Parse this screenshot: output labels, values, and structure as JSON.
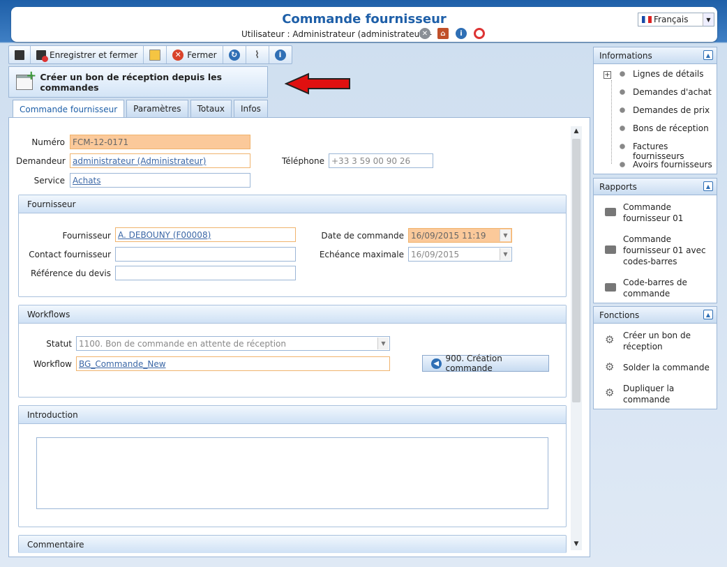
{
  "header": {
    "title": "Commande fournisseur",
    "user_line": "Utilisateur : Administrateur (administrateur)  -",
    "language": "Français"
  },
  "toolbar": {
    "save_close_label": "Enregistrer et fermer",
    "close_label": "Fermer"
  },
  "create_button_label": "Créer un bon de réception depuis les commandes",
  "tabs": [
    "Commande fournisseur",
    "Paramètres",
    "Totaux",
    "Infos"
  ],
  "form": {
    "numero_label": "Numéro",
    "numero_value": "FCM-12-0171",
    "demandeur_label": "Demandeur",
    "demandeur_value": "administrateur (Administrateur)",
    "telephone_label": "Téléphone",
    "telephone_value": "+33 3 59 00 90 26",
    "service_label": "Service",
    "service_value": "Achats"
  },
  "fournisseur_section": {
    "title": "Fournisseur",
    "fournisseur_label": "Fournisseur",
    "fournisseur_value": "A. DEBOUNY (F00008)",
    "contact_label": "Contact fournisseur",
    "contact_value": "",
    "reference_label": "Référence du devis",
    "reference_value": "",
    "date_label": "Date de commande",
    "date_value": "16/09/2015 11:19",
    "echeance_label": "Echéance maximale",
    "echeance_value": "16/09/2015"
  },
  "workflows_section": {
    "title": "Workflows",
    "statut_label": "Statut",
    "statut_value": "1100. Bon de commande en attente de réception",
    "workflow_label": "Workflow",
    "workflow_value": "BG_Commande_New",
    "action_button": "900. Création commande"
  },
  "introduction_section": {
    "title": "Introduction",
    "text": ""
  },
  "commentaire_section": {
    "title": "Commentaire"
  },
  "sidebar": {
    "informations": {
      "title": "Informations",
      "items": [
        "Lignes de détails",
        "Demandes d'achat",
        "Demandes de prix",
        "Bons de réception",
        "Factures fournisseurs",
        "Avoirs fournisseurs"
      ]
    },
    "rapports": {
      "title": "Rapports",
      "items": [
        {
          "line1": "Commande",
          "line2": "fournisseur 01",
          "line3": ""
        },
        {
          "line1": "Commande",
          "line2": "fournisseur 01 avec",
          "line3": "codes-barres"
        },
        {
          "line1": "Code-barres de",
          "line2": "commande",
          "line3": ""
        }
      ]
    },
    "fonctions": {
      "title": "Fonctions",
      "items": [
        {
          "line1": "Créer un bon de",
          "line2": "réception"
        },
        {
          "line1": "Solder la commande",
          "line2": ""
        },
        {
          "line1": "Dupliquer la",
          "line2": "commande"
        }
      ]
    }
  },
  "colors": {
    "accent": "#1e5fa8",
    "required": "#fbc99a",
    "arrow": "#e01010"
  }
}
